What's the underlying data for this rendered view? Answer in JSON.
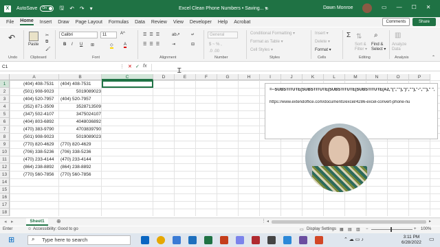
{
  "titlebar": {
    "autosave": "AutoSave",
    "toggle": "On",
    "title": "Excel Clean Phone Numbers • Saving... ▾",
    "user": "Dawn Monroe"
  },
  "menu": [
    "File",
    "Home",
    "Insert",
    "Draw",
    "Page Layout",
    "Formulas",
    "Data",
    "Review",
    "View",
    "Developer",
    "Help",
    "Acrobat"
  ],
  "menu_active": "Home",
  "comments": "Comments",
  "share": "Share",
  "ribbon": {
    "groups": [
      "Undo",
      "Clipboard",
      "Font",
      "Alignment",
      "Number",
      "Styles",
      "Cells",
      "Editing",
      "Analysis"
    ],
    "paste": "Paste",
    "font_name": "Calibri",
    "font_size": "11",
    "number_format": "General",
    "cond_format": "Conditional Formatting ▾",
    "format_table": "Format as Table ▾",
    "cell_styles": "Cell Styles ▾",
    "insert": "Insert ▾",
    "delete": "Delete ▾",
    "format": "Format ▾",
    "sort": "Sort & Filter ▾",
    "find": "Find & Select ▾",
    "analyze": "Analyze Data"
  },
  "formula_bar": {
    "namebox": "C1",
    "fx": "fx"
  },
  "columns": [
    "A",
    "B",
    "C",
    "D",
    "E",
    "F",
    "G",
    "H",
    "I",
    "J",
    "K",
    "L",
    "M",
    "N",
    "O",
    "P"
  ],
  "rows": [
    "1",
    "2",
    "3",
    "4",
    "5",
    "6",
    "7",
    "8",
    "9",
    "10",
    "11",
    "12",
    "13",
    "14",
    "15",
    "16",
    "17",
    "18"
  ],
  "data": [
    {
      "a": "(404) 408-7531",
      "b": "(404) 408-7531",
      "b_num": false
    },
    {
      "a": "(501) 908-9023",
      "b": "5019089023",
      "b_num": true
    },
    {
      "a": "(404) 520-7957",
      "b": "(404) 520-7957",
      "b_num": false
    },
    {
      "a": "(352) 871-3509",
      "b": "3528713509",
      "b_num": true
    },
    {
      "a": "(347) 502-4107",
      "b": "3475024107",
      "b_num": true
    },
    {
      "a": "(404) 803-6892",
      "b": "4048036892",
      "b_num": true
    },
    {
      "a": "(470) 383-9790",
      "b": "4703839790",
      "b_num": true
    },
    {
      "a": "(501) 908-9023",
      "b": "5019089023",
      "b_num": true
    },
    {
      "a": "(770) 820-4629",
      "b": "(770) 820-4629",
      "b_num": false
    },
    {
      "a": "(706) 338-5236",
      "b": "(706) 338-5236",
      "b_num": false
    },
    {
      "a": "(470) 233-4144",
      "b": "(470) 233-4144",
      "b_num": false
    },
    {
      "a": "(864) 238-8892",
      "b": "(864) 238-8892",
      "b_num": false
    },
    {
      "a": "(770) 560-7856",
      "b": "(770) 560-7856",
      "b_num": false
    }
  ],
  "note": {
    "formula": "=--SUBSTITUTE(SUBSTITUTE(SUBSTITUTE(SUBSTITUTE(A2,\"(\",\"\"),\")\",\"\"),\"-\",\"\"),\" \",\"\")",
    "url": "https://www.extendoffice.com/documents/excel/4286-excel-convert-phone-nu"
  },
  "sheet": "Sheet1",
  "status": {
    "mode": "Enter",
    "accessibility": "Accessibility: Good to go",
    "display": "Display Settings",
    "zoom": "100%"
  },
  "taskbar": {
    "search": "Type here to search",
    "time": "3:11 PM",
    "date": "6/28/2022"
  }
}
